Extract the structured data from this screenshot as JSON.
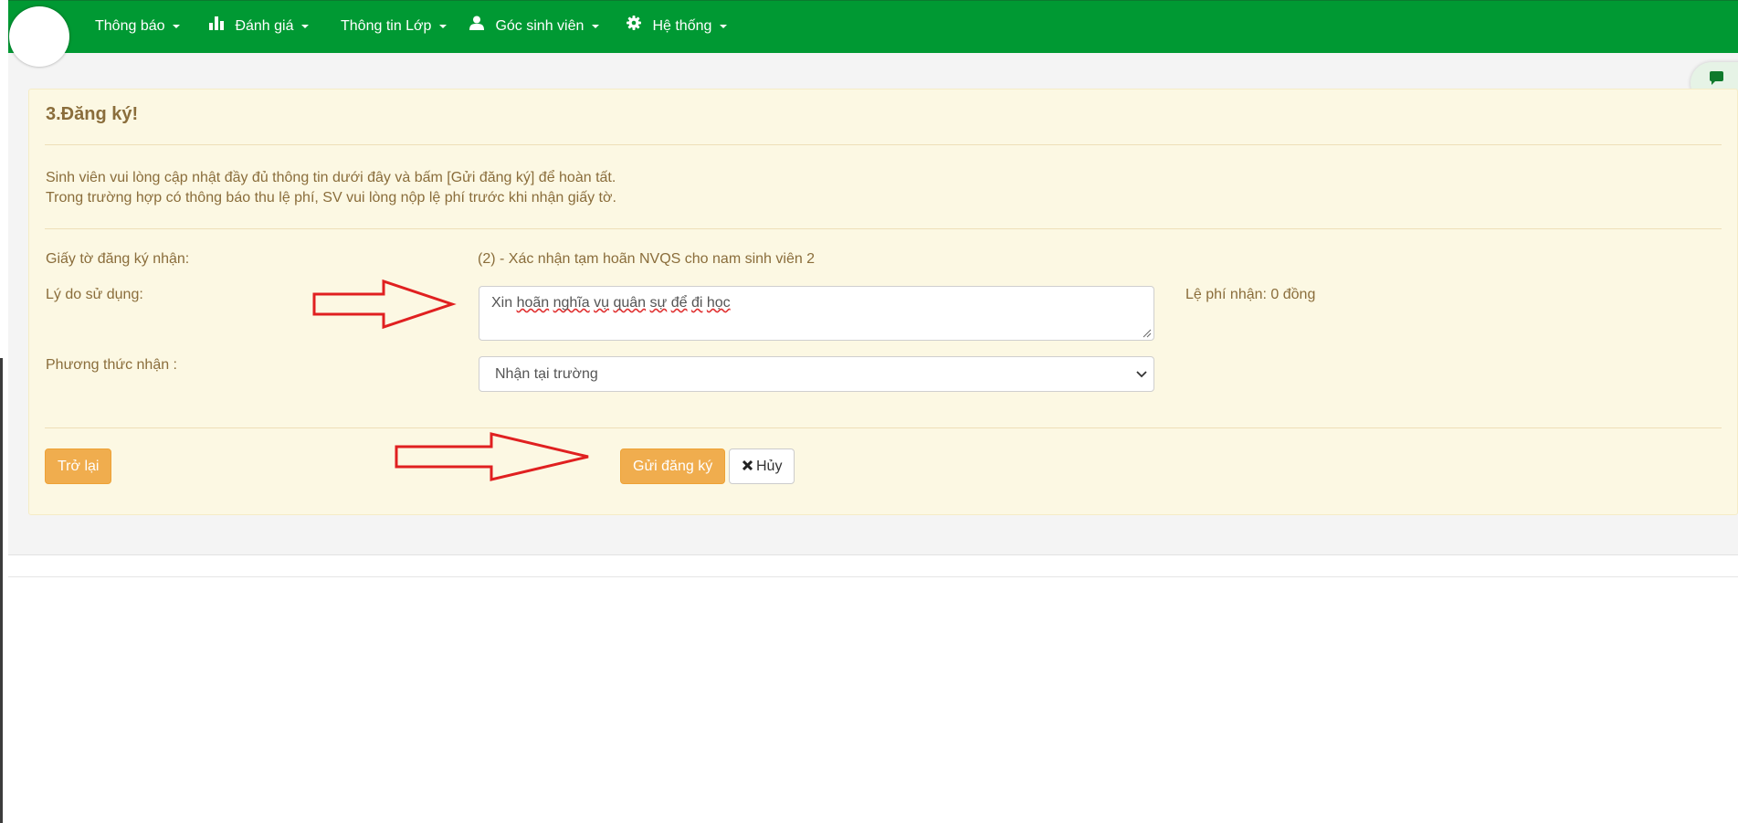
{
  "navbar": {
    "items": [
      {
        "label": "Thông báo"
      },
      {
        "label": "Đánh giá"
      },
      {
        "label": "Thông tin Lớp"
      },
      {
        "label": "Góc sinh viên"
      },
      {
        "label": "Hệ thống"
      }
    ]
  },
  "panel": {
    "title": "3.Đăng ký!",
    "intro_line1": "Sinh viên vui lòng cập nhật đầy đủ thông tin dưới đây và bấm [Gửi đăng ký] để hoàn tất.",
    "intro_line2": "Trong trường hợp có thông báo thu lệ phí, SV vui lòng nộp lệ phí trước khi nhận giấy tờ."
  },
  "form": {
    "document_label": "Giấy tờ đăng ký nhận:",
    "document_value": "(2) - Xác nhận tạm hoãn NVQS cho nam sinh viên 2",
    "reason_label": "Lý do sử dụng:",
    "reason_prefix": "Xin ",
    "reason_w1": "hoãn",
    "reason_sp1": " ",
    "reason_w2": "nghĩa",
    "reason_sp2": " ",
    "reason_w3": "vụ",
    "reason_sp3": " ",
    "reason_w4": "quân",
    "reason_sp4": " ",
    "reason_w5": "sự",
    "reason_sp5": " ",
    "reason_w6": "để",
    "reason_sp6": " ",
    "reason_w7": "đi",
    "reason_sp7": " ",
    "reason_w8": "học",
    "fee_text": "Lệ phí nhận: 0 đồng",
    "method_label": "Phương thức nhận :",
    "method_selected": "Nhận tại trường"
  },
  "buttons": {
    "back": "Trở lại",
    "submit": "Gửi đăng ký",
    "cancel": "Hủy"
  },
  "icons": {
    "chart": "bar-chart-icon",
    "user": "user-icon",
    "settings": "gear-icon",
    "chat": "chat-icon",
    "cancel": "close-icon"
  },
  "colors": {
    "navbar": "#009933",
    "panel_bg": "#fcf8e3",
    "panel_text": "#8a6d3b",
    "warning_button": "#f0ad4e",
    "annotation_arrow": "#e02020"
  }
}
